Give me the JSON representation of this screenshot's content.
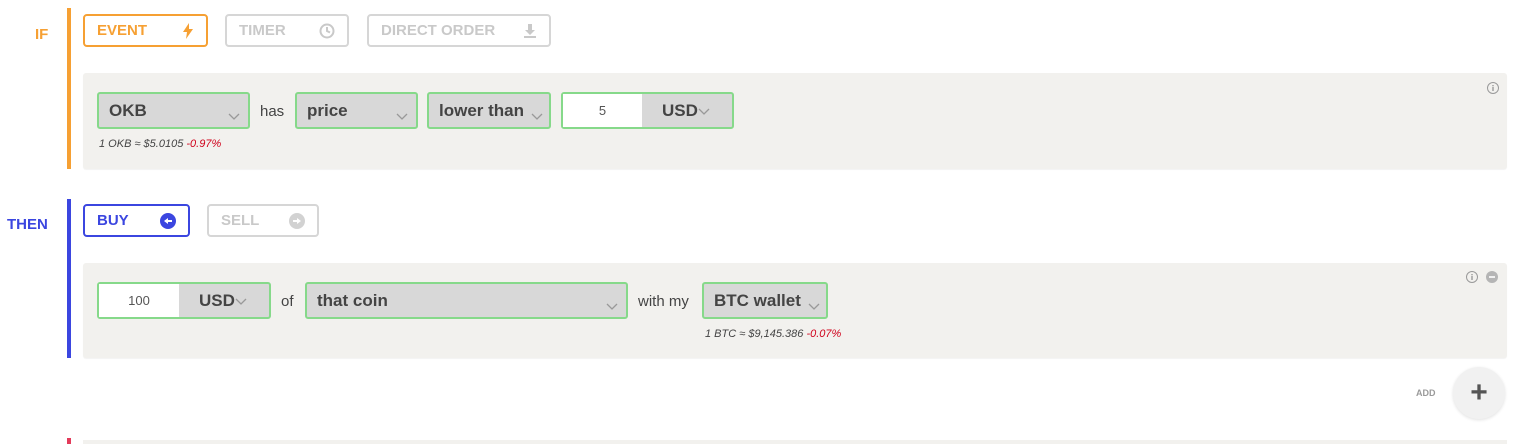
{
  "if_section": {
    "label": "IF",
    "tabs": [
      {
        "label": "EVENT",
        "icon": "lightning-icon",
        "active": true
      },
      {
        "label": "TIMER",
        "icon": "clock-icon",
        "active": false
      },
      {
        "label": "DIRECT ORDER",
        "icon": "download-icon",
        "active": false
      }
    ],
    "condition": {
      "coin": "OKB",
      "has_text": "has",
      "property": "price",
      "comparator": "lower than",
      "amount": "5",
      "currency": "USD",
      "rate_text": "1 OKB ≈ $5.0105",
      "rate_change": "-0.97%"
    }
  },
  "then_section": {
    "label": "THEN",
    "tabs": [
      {
        "label": "BUY",
        "icon": "arrow-left-circle-icon",
        "active": true
      },
      {
        "label": "SELL",
        "icon": "arrow-right-circle-icon",
        "active": false
      }
    ],
    "action": {
      "amount": "100",
      "currency": "USD",
      "of_text": "of",
      "target": "that coin",
      "with_text": "with my",
      "wallet": "BTC wallet",
      "rate_text": "1 BTC ≈ $9,145.386",
      "rate_change": "-0.07%"
    }
  },
  "add": {
    "label": "ADD",
    "icon": "plus-icon"
  },
  "colors": {
    "if_accent": "#f6a033",
    "then_accent": "#3b46e0",
    "select_border": "#86d98a",
    "negative": "#d0021b",
    "panel_bg": "#f2f1ee"
  }
}
